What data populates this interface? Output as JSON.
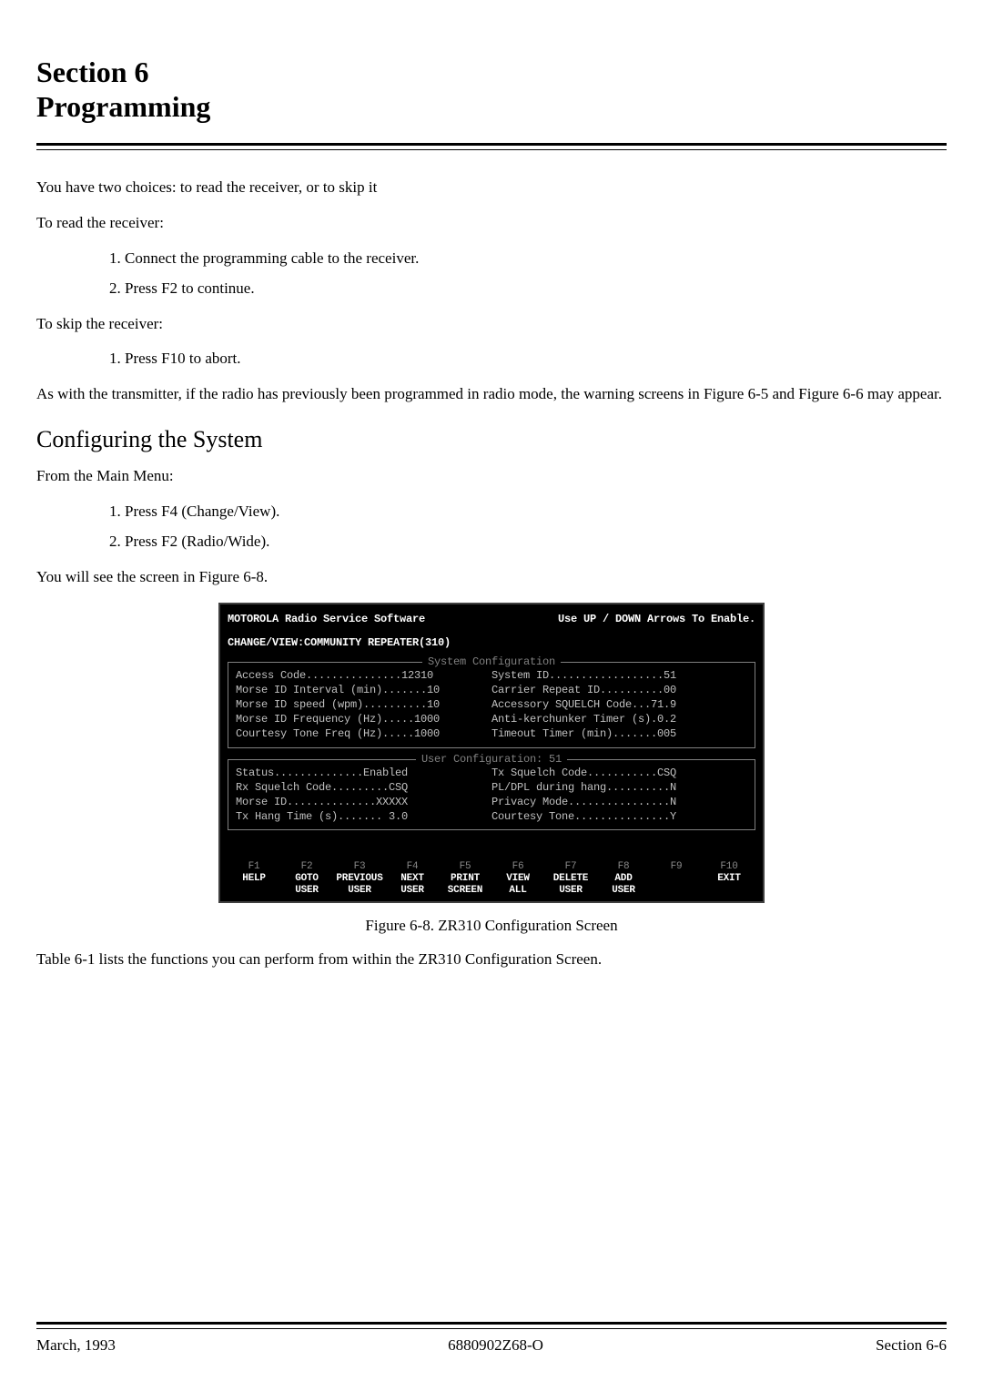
{
  "header": {
    "line1": "Section 6",
    "line2": "Programming"
  },
  "body": {
    "p1": "You have two choices: to read the receiver, or to skip it",
    "p2": "To read the receiver:",
    "read_steps": {
      "s1": "1. Connect the programming cable to the receiver.",
      "s2": "2. Press F2 to continue."
    },
    "p3": "To skip the receiver:",
    "skip_steps": {
      "s1": "1. Press F10 to abort."
    },
    "p4": "As with the transmitter, if the radio has previously been programmed in radio mode, the warning screens in Figure 6-5 and Figure 6-6 may appear.",
    "h2": "Configuring the System",
    "p5": "From the Main Menu:",
    "menu_steps": {
      "s1": "1. Press F4 (Change/View).",
      "s2": "2. Press F2 (Radio/Wide)."
    },
    "p6": "You will see the screen in Figure 6-8.",
    "caption": "Figure 6-8. ZR310 Configuration Screen",
    "p7": "Table 6-1 lists the functions you can perform from within the ZR310 Configuration Screen."
  },
  "terminal": {
    "title_left": "MOTOROLA Radio Service Software",
    "title_right": "Use UP / DOWN Arrows To Enable.",
    "subtitle": "CHANGE/VIEW:COMMUNITY REPEATER(310)",
    "box1_title": "System Configuration",
    "box1_left": {
      "l1": "Access Code...............12310",
      "l2": "Morse ID Interval (min).......10",
      "l3": "Morse ID speed (wpm)..........10",
      "l4": "Morse ID Frequency (Hz).....1000",
      "l5": "Courtesy Tone Freq (Hz).....1000"
    },
    "box1_right": {
      "l1": "System ID..................51",
      "l2": "Carrier Repeat ID..........00",
      "l3": "Accessory SQUELCH Code...71.9",
      "l4": "Anti-kerchunker Timer (s).0.2",
      "l5": "Timeout Timer (min).......005"
    },
    "box2_title": "User Configuration: 51",
    "box2_left": {
      "l1": "Status..............Enabled",
      "l2": "Rx Squelch Code.........CSQ",
      "l3": "Morse ID..............XXXXX",
      "l4": "Tx Hang Time (s)....... 3.0"
    },
    "box2_right": {
      "l1": "Tx Squelch Code...........CSQ",
      "l2": "PL/DPL during hang..........N",
      "l3": "Privacy Mode................N",
      "l4": "Courtesy Tone...............Y"
    },
    "fkeys": {
      "f1": {
        "num": "F1",
        "t1": "HELP",
        "t2": ""
      },
      "f2": {
        "num": "F2",
        "t1": "GOTO",
        "t2": "USER"
      },
      "f3": {
        "num": "F3",
        "t1": "PREVIOUS",
        "t2": "USER"
      },
      "f4": {
        "num": "F4",
        "t1": "NEXT",
        "t2": "USER"
      },
      "f5": {
        "num": "F5",
        "t1": "PRINT",
        "t2": "SCREEN"
      },
      "f6": {
        "num": "F6",
        "t1": "VIEW",
        "t2": "ALL"
      },
      "f7": {
        "num": "F7",
        "t1": "DELETE",
        "t2": "USER"
      },
      "f8": {
        "num": "F8",
        "t1": "ADD",
        "t2": "USER"
      },
      "f9": {
        "num": "F9",
        "t1": "",
        "t2": ""
      },
      "f10": {
        "num": "F10",
        "t1": "EXIT",
        "t2": ""
      }
    }
  },
  "footer": {
    "left": "March, 1993",
    "center": "6880902Z68-O",
    "right": "Section 6-6"
  }
}
